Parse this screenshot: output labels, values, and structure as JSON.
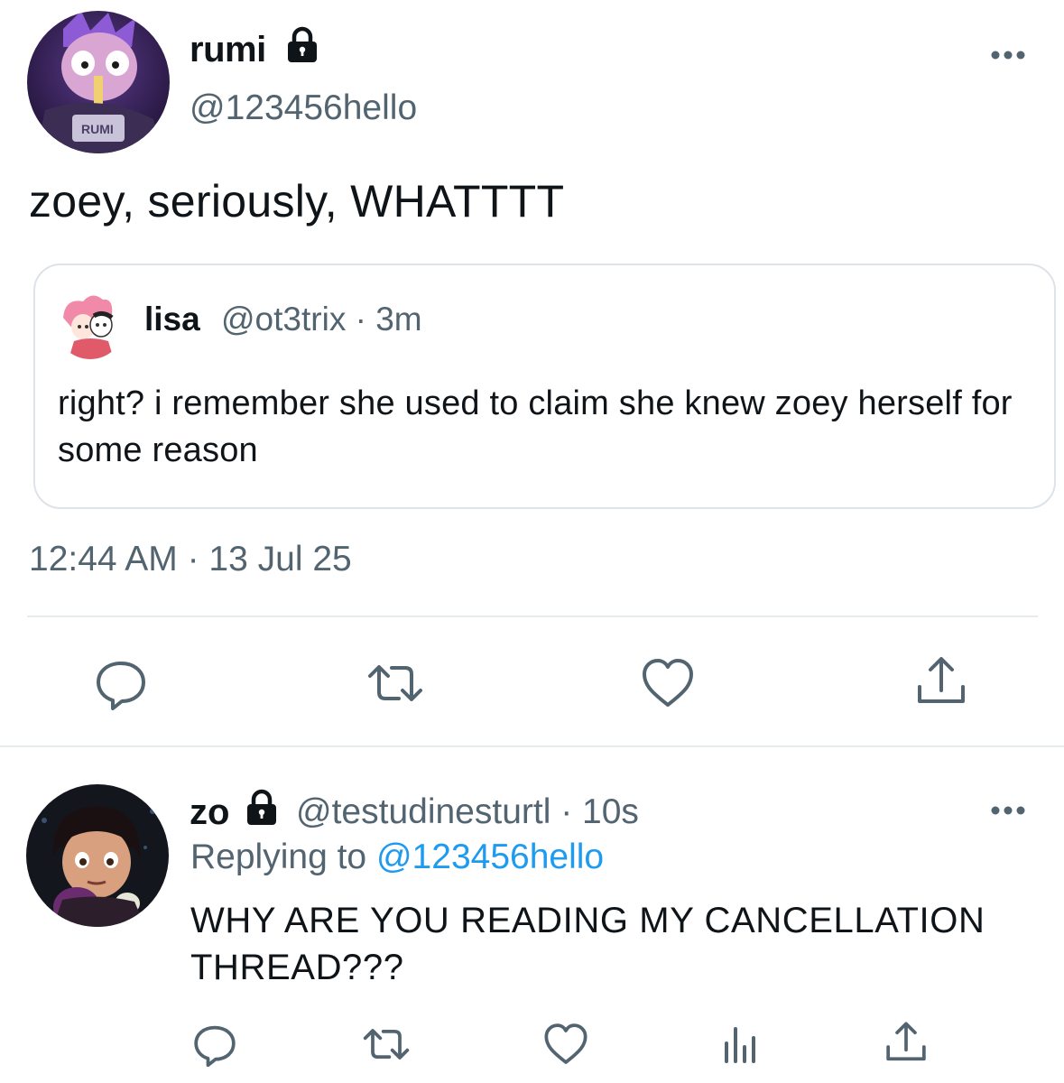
{
  "main_tweet": {
    "display_name": "rumi",
    "handle": "@123456hello",
    "protected": true,
    "text": "zoey, seriously, WHATTTT",
    "timestamp": "12:44 AM · 13 Jul 25",
    "avatar_caption": "RUMI",
    "quoted": {
      "display_name": "lisa",
      "meta": "@ot3trix · 3m",
      "text": "right? i remember she used to claim she knew zoey herself for some reason"
    },
    "actions": [
      "reply-icon",
      "retweet-icon",
      "heart-icon",
      "share-icon"
    ]
  },
  "reply_tweet": {
    "display_name": "zo",
    "protected": true,
    "meta": "@testudinesturtl · 10s",
    "replying_label": "Replying to",
    "replying_mention": "@123456hello",
    "text": "WHY ARE YOU READING MY CANCELLATION THREAD???",
    "actions": [
      "reply-icon",
      "retweet-icon",
      "heart-icon",
      "views-icon",
      "share-icon"
    ]
  },
  "colors": {
    "text_primary": "#0f1419",
    "text_secondary": "#536471",
    "link": "#1d9bf0",
    "border": "#dde3e8"
  }
}
